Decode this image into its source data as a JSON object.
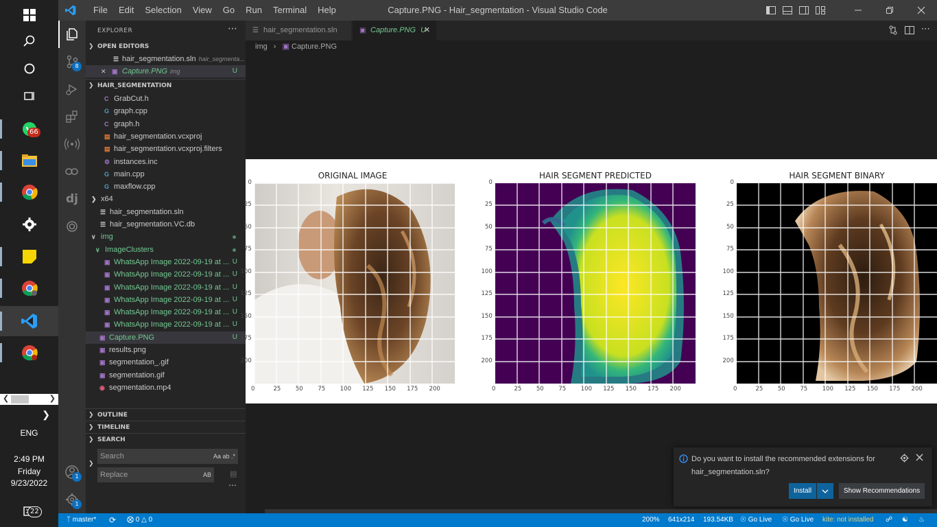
{
  "window": {
    "title": "Capture.PNG - Hair_segmentation - Visual Studio Code",
    "menu": [
      "File",
      "Edit",
      "Selection",
      "View",
      "Go",
      "Run",
      "Terminal",
      "Help"
    ]
  },
  "taskbar": {
    "whatsapp_badge": "66",
    "language": "ENG",
    "time": "2:49 PM",
    "day": "Friday",
    "date": "9/23/2022",
    "notifications_badge": "22"
  },
  "activity": {
    "source_control_badge": "8",
    "accounts_badge": "1",
    "settings_badge": "1"
  },
  "sidebar": {
    "title": "EXPLORER",
    "open_editors_label": "OPEN EDITORS",
    "open_editors": [
      {
        "name": "hair_segmentation.sln",
        "detail": "hair_segmenta..."
      },
      {
        "name": "Capture.PNG",
        "detail": "img",
        "status": "U"
      }
    ],
    "project_label": "HAIR_SEGMENTATION",
    "files": [
      {
        "icon": "C",
        "name": "GrabCut.h"
      },
      {
        "icon": "G",
        "name": "graph.cpp"
      },
      {
        "icon": "C",
        "name": "graph.h"
      },
      {
        "icon": "R",
        "name": "hair_segmentation.vcxproj"
      },
      {
        "icon": "R",
        "name": "hair_segmentation.vcxproj.filters"
      },
      {
        "icon": "A",
        "name": "instances.inc"
      },
      {
        "icon": "G",
        "name": "main.cpp"
      },
      {
        "icon": "G",
        "name": "maxflow.cpp"
      },
      {
        "icon": ">",
        "name": "x64"
      },
      {
        "icon": "S",
        "name": "hair_segmentation.sln"
      },
      {
        "icon": "S",
        "name": "hair_segmentation.VC.db"
      },
      {
        "icon": "v",
        "name": "img"
      },
      {
        "icon": "v",
        "name": "ImageClusters"
      },
      {
        "icon": "I",
        "name": "WhatsApp Image 2022-09-19 at ...",
        "status": "U"
      },
      {
        "icon": "I",
        "name": "WhatsApp Image 2022-09-19 at ...",
        "status": "U"
      },
      {
        "icon": "I",
        "name": "WhatsApp Image 2022-09-19 at ...",
        "status": "U"
      },
      {
        "icon": "I",
        "name": "WhatsApp Image 2022-09-19 at ...",
        "status": "U"
      },
      {
        "icon": "I",
        "name": "WhatsApp Image 2022-09-19 at ...",
        "status": "U"
      },
      {
        "icon": "I",
        "name": "WhatsApp Image 2022-09-19 at ...",
        "status": "U"
      },
      {
        "icon": "I",
        "name": "Capture.PNG",
        "status": "U"
      },
      {
        "icon": "I",
        "name": "results.png"
      },
      {
        "icon": "I",
        "name": "segmentation_.gif"
      },
      {
        "icon": "I",
        "name": "segmentation.gif"
      },
      {
        "icon": "M",
        "name": "segmentation.mp4"
      }
    ],
    "outline_label": "OUTLINE",
    "timeline_label": "TIMELINE",
    "search_label": "SEARCH",
    "search_placeholder": "Search",
    "replace_placeholder": "Replace",
    "search_opts": "Aa  ab  .*",
    "replace_opts": "AB"
  },
  "editor": {
    "tabs": [
      {
        "label": "hair_segmentation.sln"
      },
      {
        "label": "Capture.PNG",
        "status": "U"
      }
    ],
    "breadcrumb": [
      "img",
      "Capture.PNG"
    ],
    "panels": [
      "ORIGINAL IMAGE",
      "HAIR SEGMENT PREDICTED",
      "HAIR SEGMENT BINARY"
    ],
    "x_ticks": [
      "0",
      "25",
      "50",
      "75",
      "100",
      "125",
      "150",
      "175",
      "200"
    ],
    "y_ticks": [
      "0",
      "25",
      "50",
      "75",
      "100",
      "125",
      "150",
      "175",
      "200"
    ]
  },
  "notification": {
    "message": "Do you want to install the recommended extensions for hair_segmentation.sln?",
    "install_label": "Install",
    "recommend_label": "Show Recommendations"
  },
  "statusbar": {
    "branch": "master*",
    "errors": "0",
    "warnings": "0",
    "zoom": "200%",
    "dimensions": "641x214",
    "size": "193.54KB",
    "golive1": "Go Live",
    "golive2": "Go Live",
    "kite": "kite: not installed"
  },
  "colors": {
    "accent": "#007acc",
    "untracked": "#73c991",
    "viridis_low": "#440154",
    "viridis_high": "#fde725"
  }
}
